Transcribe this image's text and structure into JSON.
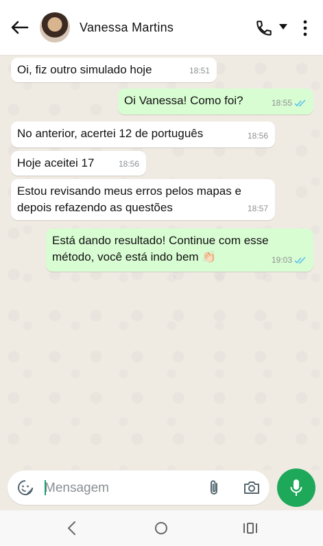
{
  "header": {
    "contact_name": "Vanessa Martins"
  },
  "messages": [
    {
      "direction": "in",
      "text": "Oi, fiz outro simulado hoje",
      "time": "18:51"
    },
    {
      "direction": "out",
      "text": "Oi Vanessa! Como foi?",
      "time": "18:55",
      "status": "read"
    },
    {
      "direction": "in",
      "text": "No anterior, acertei 12 de português",
      "time": "18:56"
    },
    {
      "direction": "in",
      "text": "Hoje aceitei 17",
      "time": "18:56"
    },
    {
      "direction": "in",
      "text": "Estou revisando meus erros pelos mapas e depois refazendo as questões",
      "time": "18:57"
    },
    {
      "direction": "out",
      "text": "Está dando resultado! Continue com esse método, você está indo bem 👏🏻",
      "time": "19:03",
      "status": "read"
    }
  ],
  "composer": {
    "placeholder": "Mensagem",
    "value": ""
  },
  "colors": {
    "outgoing_bubble": "#d9fdd3",
    "incoming_bubble": "#ffffff",
    "chat_background": "#efeae2",
    "read_ticks": "#53bdeb",
    "accent_green": "#1ea85a"
  },
  "icons": {
    "back": "arrow-left-icon",
    "call": "phone-icon",
    "call_menu": "caret-down-icon",
    "menu": "more-vertical-icon",
    "emoji": "sticker-smile-icon",
    "attach": "paperclip-icon",
    "camera": "camera-icon",
    "mic": "microphone-icon",
    "read_status": "double-check-icon"
  }
}
